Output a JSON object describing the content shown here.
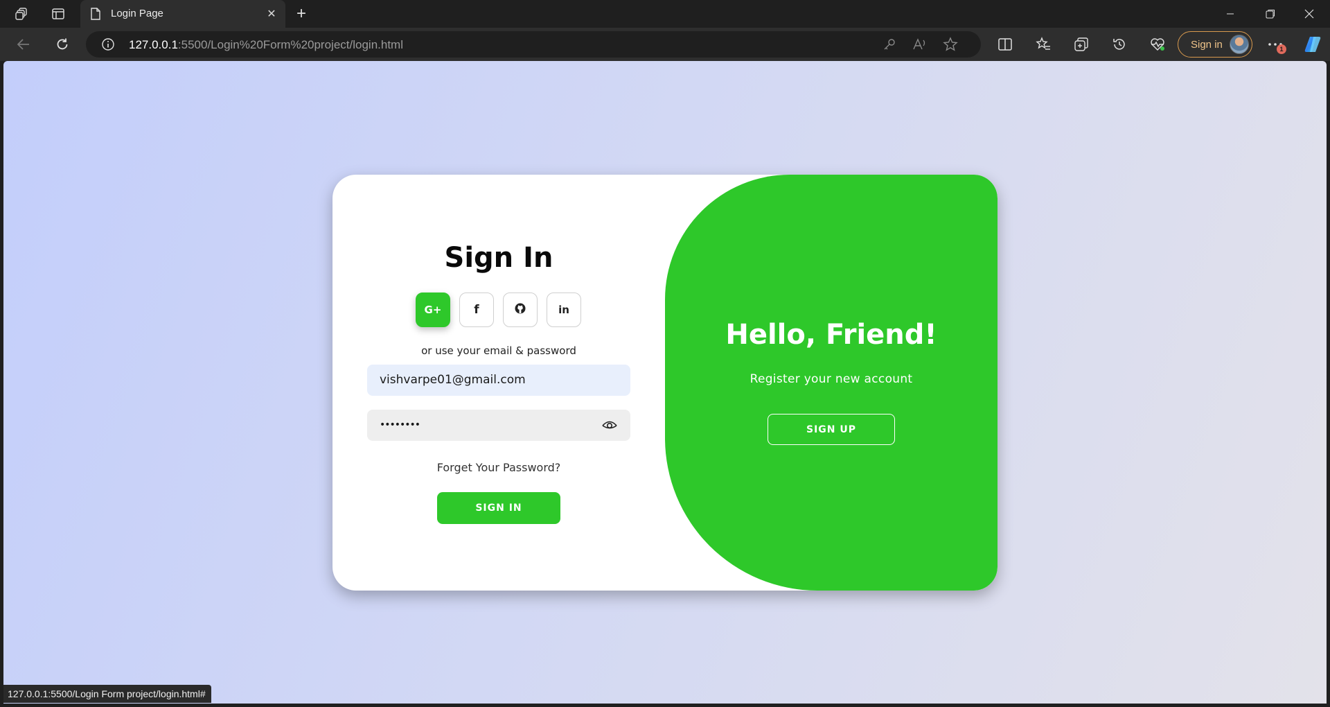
{
  "browser": {
    "tab_title": "Login Page",
    "url_host": "127.0.0.1",
    "url_path": ":5500/Login%20Form%20project/login.html",
    "profile_signin_label": "Sign in",
    "notification_count": "1",
    "status_url": "127.0.0.1:5500/Login Form project/login.html#"
  },
  "signin": {
    "title": "Sign In",
    "social": [
      {
        "icon": "google-plus-icon",
        "glyph": "G+",
        "active": true
      },
      {
        "icon": "facebook-icon",
        "glyph": "f",
        "active": false
      },
      {
        "icon": "github-icon",
        "glyph": "",
        "active": false
      },
      {
        "icon": "linkedin-icon",
        "glyph": "in",
        "active": false
      }
    ],
    "alt_text": "or use your email & password",
    "email_value": "vishvarpe01@gmail.com",
    "password_masked": "••••••••",
    "forgot_link": "Forget Your Password?",
    "submit_label": "SIGN IN"
  },
  "promo": {
    "title": "Hello, Friend!",
    "subtitle": "Register your new account",
    "signup_label": "SIGN UP"
  },
  "colors": {
    "accent_green": "#2ec82a",
    "chrome_dark": "#1f1f1f",
    "toolbar": "#2e2e2e",
    "profile_outline": "#d99a4e"
  }
}
